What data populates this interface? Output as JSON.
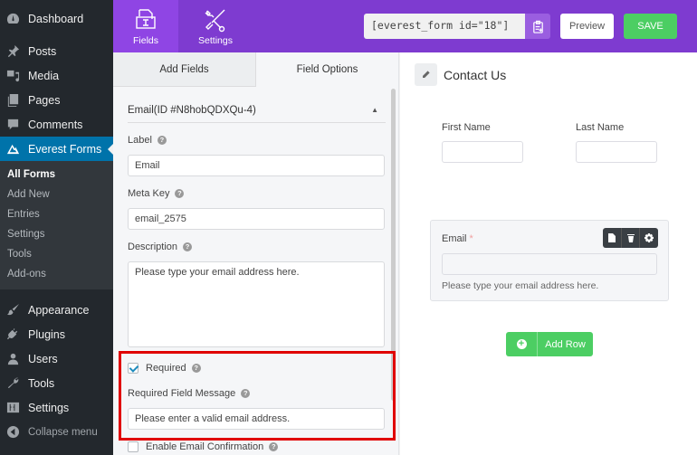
{
  "sidebar": {
    "items_top": [
      {
        "label": "Dashboard",
        "icon": "dashboard-icon"
      },
      {
        "label": "Posts",
        "icon": "pin-icon"
      },
      {
        "label": "Media",
        "icon": "media-icon"
      },
      {
        "label": "Pages",
        "icon": "pages-icon"
      },
      {
        "label": "Comments",
        "icon": "comment-icon"
      },
      {
        "label": "Everest Forms",
        "icon": "everest-forms-icon",
        "active": true
      }
    ],
    "submenu": [
      {
        "label": "All Forms",
        "current": true
      },
      {
        "label": "Add New"
      },
      {
        "label": "Entries"
      },
      {
        "label": "Settings"
      },
      {
        "label": "Tools"
      },
      {
        "label": "Add-ons"
      }
    ],
    "items_bottom": [
      {
        "label": "Appearance",
        "icon": "paintbrush-icon"
      },
      {
        "label": "Plugins",
        "icon": "plugin-icon"
      },
      {
        "label": "Users",
        "icon": "user-icon"
      },
      {
        "label": "Tools",
        "icon": "wrench-icon"
      },
      {
        "label": "Settings",
        "icon": "settings-sliders-icon"
      }
    ],
    "collapse_label": "Collapse menu"
  },
  "topbar": {
    "tabs": [
      {
        "label": "Fields",
        "icon": "fields-icon",
        "active": true
      },
      {
        "label": "Settings",
        "icon": "tools-icon"
      }
    ],
    "shortcode": "[everest_form id=\"18\"]",
    "preview_label": "Preview",
    "save_label": "SAVE",
    "brand_color": "#7e3bd0",
    "save_color": "#4cce63"
  },
  "options_panel": {
    "tabs": [
      {
        "label": "Add Fields",
        "selected": false
      },
      {
        "label": "Field Options",
        "selected": true
      }
    ],
    "section_title": "Email(ID #N8hobQDXQu-4)",
    "label_title": "Label",
    "label_value": "Email",
    "meta_key_title": "Meta Key",
    "meta_key_value": "email_2575",
    "description_title": "Description",
    "description_value": "Please type your email address here.",
    "required_label": "Required",
    "required_checked": true,
    "required_message_title": "Required Field Message",
    "required_message_value": "Please enter a valid email address.",
    "email_confirmation_label": "Enable Email Confirmation",
    "email_confirmation_checked": false,
    "help_glyph": "?"
  },
  "canvas": {
    "form_title": "Contact Us",
    "first_name_label": "First Name",
    "last_name_label": "Last Name",
    "email_label": "Email",
    "required_marker": "*",
    "email_description": "Please type your email address here.",
    "add_row_label": "Add Row",
    "add_row_plus": "+"
  }
}
